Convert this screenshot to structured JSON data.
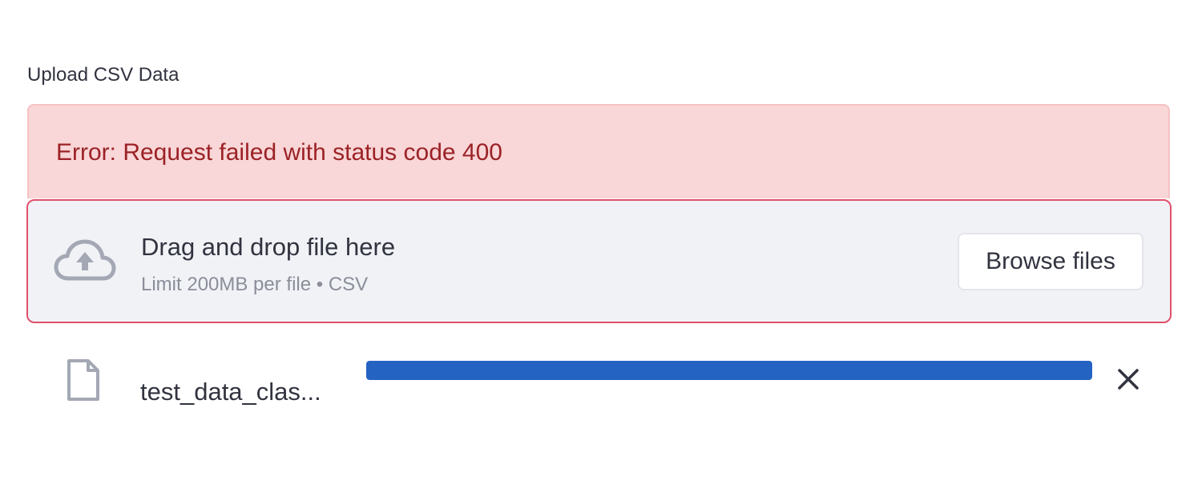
{
  "uploader": {
    "label": "Upload CSV Data",
    "error": "Error: Request failed with status code 400",
    "dropzone": {
      "icon": "cloud-upload-icon",
      "title": "Drag and drop file here",
      "subtitle": "Limit 200MB per file • CSV",
      "browse_label": "Browse files"
    },
    "file": {
      "icon": "file-icon",
      "name": "test_data_clas...",
      "progress_percent": 100,
      "remove_icon": "close-icon"
    }
  },
  "colors": {
    "error_bg": "#f9d6d7",
    "error_text": "#9b2226",
    "dropzone_border": "#e0506a",
    "dropzone_bg": "#f0f2f6",
    "progress": "#2563c3",
    "icon_gray": "#a3a8b4"
  }
}
